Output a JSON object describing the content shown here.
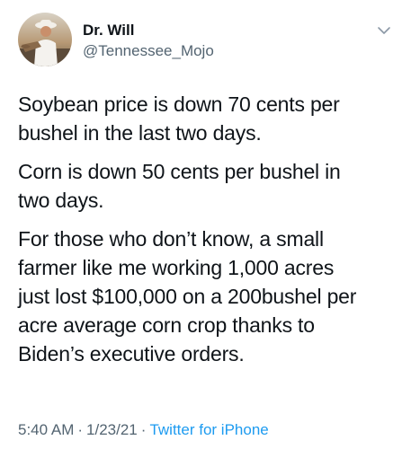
{
  "author": {
    "display_name": "Dr. Will",
    "handle": "@Tennessee_Mojo"
  },
  "tweet": {
    "paragraphs": [
      "Soybean price is down 70 cents per\nbushel in the last two days.",
      "Corn is down 50 cents per bushel in\ntwo days.",
      "For those who don’t know, a small\nfarmer like me working 1,000 acres\njust lost $100,000 on a 200bushel per\nacre average corn crop thanks to\nBiden’s executive orders."
    ]
  },
  "meta": {
    "time": "5:40 AM",
    "date": "1/23/21",
    "separator": "·",
    "source": "Twitter for iPhone"
  },
  "colors": {
    "text": "#0f1419",
    "secondary": "#536471",
    "link": "#1d9bf0",
    "background": "#ffffff"
  },
  "icons": {
    "menu": "chevron-down-icon",
    "avatar": "profile-photo"
  }
}
